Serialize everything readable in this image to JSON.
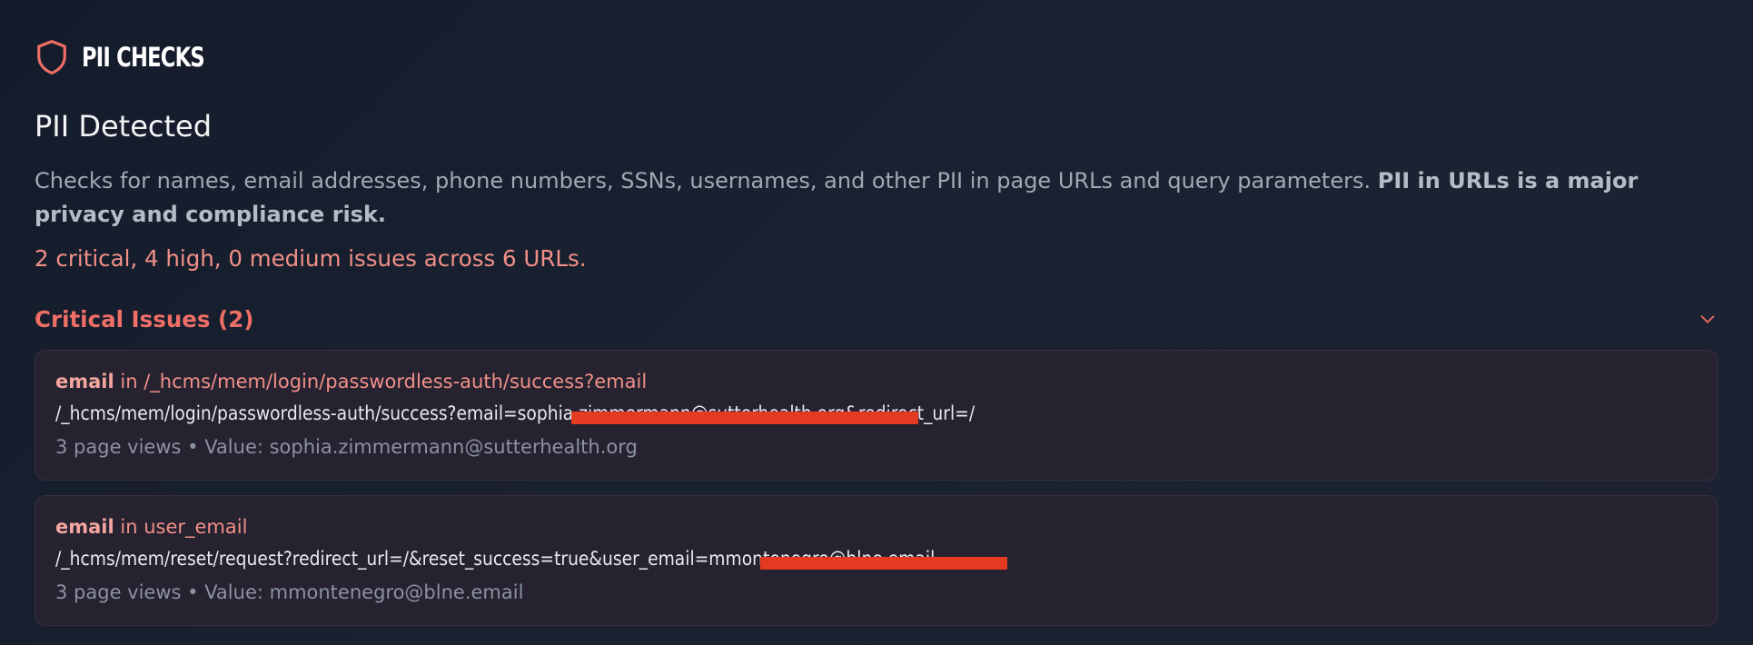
{
  "header": {
    "brand": "PII CHECKS",
    "icon": "shield-icon"
  },
  "page": {
    "title": "PII Detected",
    "description": "Checks for names, email addresses, phone numbers, SSNs, usernames, and other PII in page URLs and query parameters. ",
    "description_bold": "PII in URLs is a major privacy and compliance risk.",
    "summary": "2 critical, 4 high, 0 medium issues across 6 URLs."
  },
  "section": {
    "title": "Critical Issues (2)",
    "expanded": true
  },
  "issues": [
    {
      "type": "email",
      "connector": " in ",
      "location": "/_hcms/mem/login/passwordless-auth/success?email",
      "url": "/_hcms/mem/login/passwordless-auth/success?email=sophia.zimmermann@sutterhealth.org&redirect_url=/",
      "meta": "3 page views • Value: sophia.zimmermann@sutterhealth.org"
    },
    {
      "type": "email",
      "connector": " in ",
      "location": "user_email",
      "url": "/_hcms/mem/reset/request?redirect_url=/&reset_success=true&user_email=mmontenegro@blne.email",
      "meta": "3 page views • Value: mmontenegro@blne.email"
    }
  ],
  "colors": {
    "background": "#161d2c",
    "critical": "#ef6e66",
    "card_bg": "#262230",
    "redaction": "#e43a22"
  }
}
